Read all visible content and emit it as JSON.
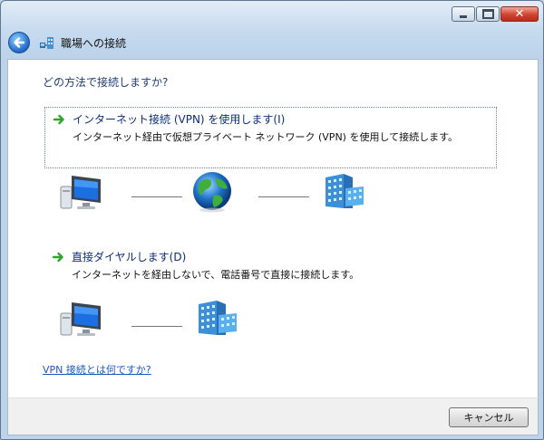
{
  "window": {
    "title": "職場への接続",
    "buttons": {
      "minimize_icon": "minimize-icon",
      "maximize_icon": "maximize-icon",
      "close_icon": "close-icon"
    }
  },
  "nav": {
    "back_icon": "back-arrow-icon",
    "app_icon": "workplace-network-icon"
  },
  "main": {
    "question": "どの方法で接続しますか?",
    "options": [
      {
        "title": "インターネット接続 (VPN) を使用します(I)",
        "description": "インターネット経由で仮想プライベート ネットワーク (VPN) を使用して接続します。",
        "diagram": [
          "computer-icon",
          "globe-icon",
          "office-building-icon"
        ]
      },
      {
        "title": "直接ダイヤルします(D)",
        "description": "インターネットを経由しないで、電話番号で直接に接続します。",
        "diagram": [
          "computer-icon",
          "office-building-icon"
        ]
      }
    ],
    "help_link": "VPN 接続とは何ですか?"
  },
  "footer": {
    "cancel_label": "キャンセル"
  },
  "colors": {
    "accent_link": "#1b58c2",
    "heading_text": "#1e3c78",
    "close_button": "#cf4330",
    "arrow_green": "#2ea52a"
  }
}
